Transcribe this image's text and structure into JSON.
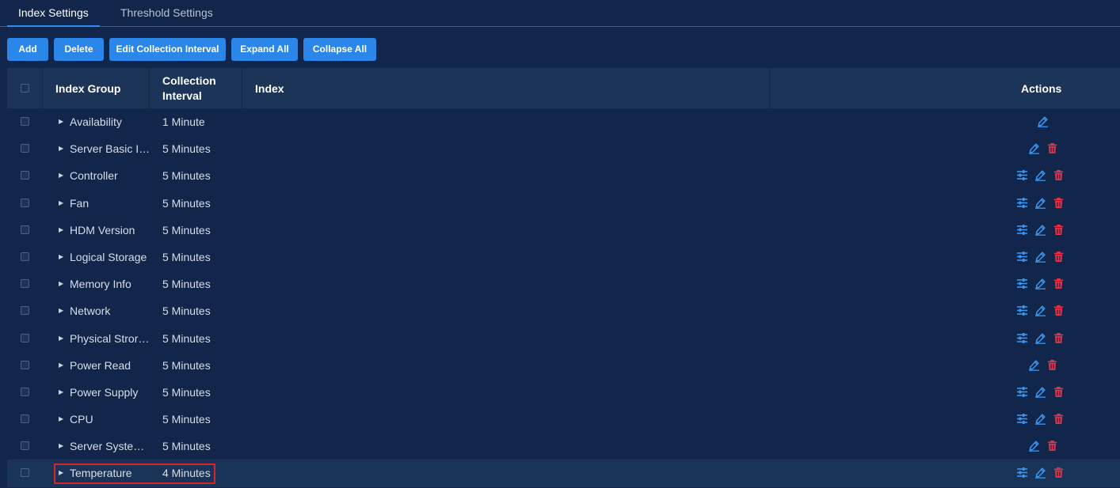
{
  "tabs": [
    {
      "label": "Index Settings",
      "active": true
    },
    {
      "label": "Threshold Settings",
      "active": false
    }
  ],
  "toolbar": {
    "add_label": "Add",
    "delete_label": "Delete",
    "edit_interval_label": "Edit Collection Interval",
    "expand_all_label": "Expand All",
    "collapse_all_label": "Collapse All"
  },
  "table": {
    "headers": {
      "index_group": "Index Group",
      "collection_interval_line1": "Collection",
      "collection_interval_line2": "Interval",
      "index": "Index",
      "actions": "Actions"
    },
    "rows": [
      {
        "group": "Availability",
        "interval": "1 Minute",
        "actions": [
          "edit-icon"
        ]
      },
      {
        "group": "Server Basic Info",
        "interval": "5 Minutes",
        "actions": [
          "edit-icon",
          "delete-icon"
        ]
      },
      {
        "group": "Controller",
        "interval": "5 Minutes",
        "actions": [
          "settings-sliders-icon",
          "edit-icon",
          "delete-icon"
        ]
      },
      {
        "group": "Fan",
        "interval": "5 Minutes",
        "actions": [
          "settings-sliders-icon",
          "edit-icon",
          "delete-icon"
        ]
      },
      {
        "group": "HDM Version",
        "interval": "5 Minutes",
        "actions": [
          "settings-sliders-icon",
          "edit-icon",
          "delete-icon"
        ]
      },
      {
        "group": "Logical Storage",
        "interval": "5 Minutes",
        "actions": [
          "settings-sliders-icon",
          "edit-icon",
          "delete-icon"
        ]
      },
      {
        "group": "Memory Info",
        "interval": "5 Minutes",
        "actions": [
          "settings-sliders-icon",
          "edit-icon",
          "delete-icon"
        ]
      },
      {
        "group": "Network",
        "interval": "5 Minutes",
        "actions": [
          "settings-sliders-icon",
          "edit-icon",
          "delete-icon"
        ]
      },
      {
        "group": "Physical Strora...",
        "interval": "5 Minutes",
        "actions": [
          "settings-sliders-icon",
          "edit-icon",
          "delete-icon"
        ]
      },
      {
        "group": "Power Read",
        "interval": "5 Minutes",
        "actions": [
          "edit-icon",
          "delete-icon"
        ]
      },
      {
        "group": "Power Supply",
        "interval": "5 Minutes",
        "actions": [
          "settings-sliders-icon",
          "edit-icon",
          "delete-icon"
        ]
      },
      {
        "group": "CPU",
        "interval": "5 Minutes",
        "actions": [
          "settings-sliders-icon",
          "edit-icon",
          "delete-icon"
        ]
      },
      {
        "group": "Server System ...",
        "interval": "5 Minutes",
        "actions": [
          "edit-icon",
          "delete-icon"
        ]
      },
      {
        "group": "Temperature",
        "interval": "4 Minutes",
        "actions": [
          "settings-sliders-icon",
          "edit-icon",
          "delete-icon"
        ],
        "highlighted": true
      }
    ]
  },
  "colors": {
    "background": "#11264a",
    "header_bg": "#1b3458",
    "button_blue": "#2b86ea",
    "icon_blue": "#3a97f4",
    "icon_red": "#e8334a",
    "outline_red": "#d3252a"
  }
}
